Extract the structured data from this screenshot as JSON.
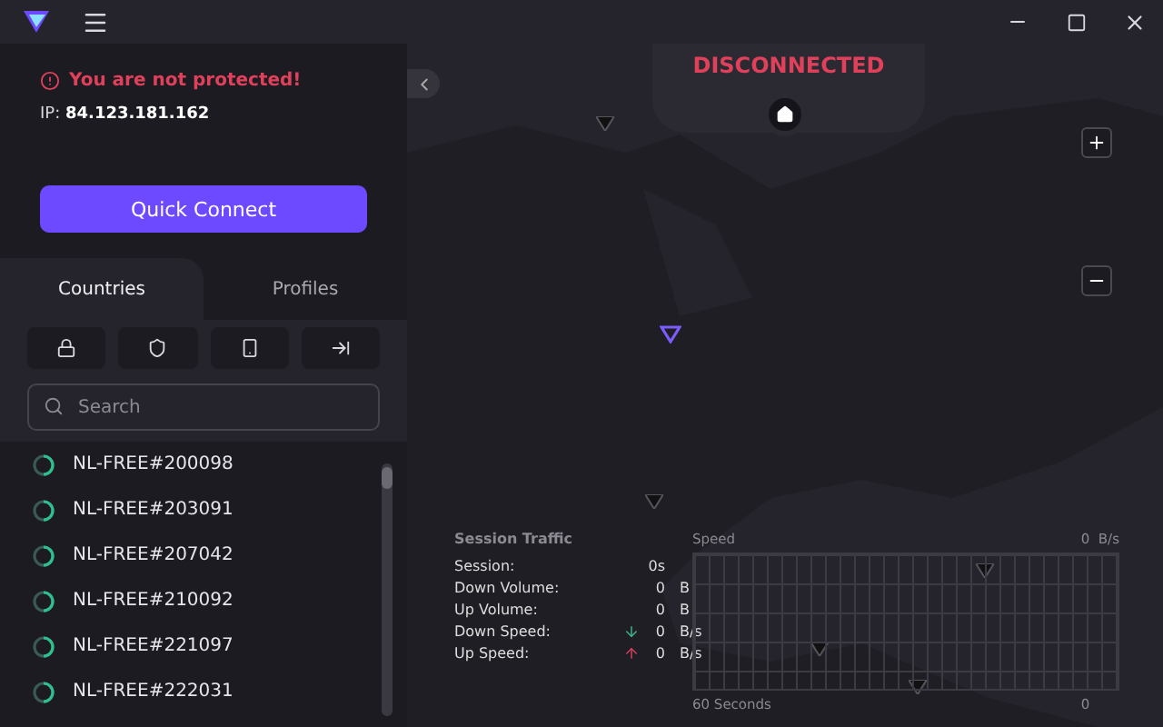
{
  "status": {
    "warning": "You are not protected!",
    "ip_label": "IP:",
    "ip": "84.123.181.162"
  },
  "quick_connect": "Quick Connect",
  "tabs": [
    {
      "label": "Countries",
      "selected": true
    },
    {
      "label": "Profiles",
      "selected": false
    }
  ],
  "search": {
    "placeholder": "Search"
  },
  "servers": [
    {
      "name": "NL-FREE#200098"
    },
    {
      "name": "NL-FREE#203091"
    },
    {
      "name": "NL-FREE#207042"
    },
    {
      "name": "NL-FREE#210092"
    },
    {
      "name": "NL-FREE#221097"
    },
    {
      "name": "NL-FREE#222031"
    }
  ],
  "connection": {
    "state": "DISCONNECTED"
  },
  "session_traffic": {
    "title": "Session Traffic",
    "rows": [
      {
        "label": "Session:",
        "value": "0s",
        "kind": "plain"
      },
      {
        "label": "Down Volume:",
        "value": "0",
        "unit": "B",
        "kind": "plain"
      },
      {
        "label": "Up Volume:",
        "value": "0",
        "unit": "B",
        "kind": "plain"
      },
      {
        "label": "Down Speed:",
        "value": "0",
        "unit": "B/s",
        "kind": "download"
      },
      {
        "label": "Up Speed:",
        "value": "0",
        "unit": "B/s",
        "kind": "upload"
      }
    ]
  },
  "speed_graph": {
    "title": "Speed",
    "max": "0  B/s",
    "x_label": "60 Seconds",
    "x_end": "0"
  }
}
